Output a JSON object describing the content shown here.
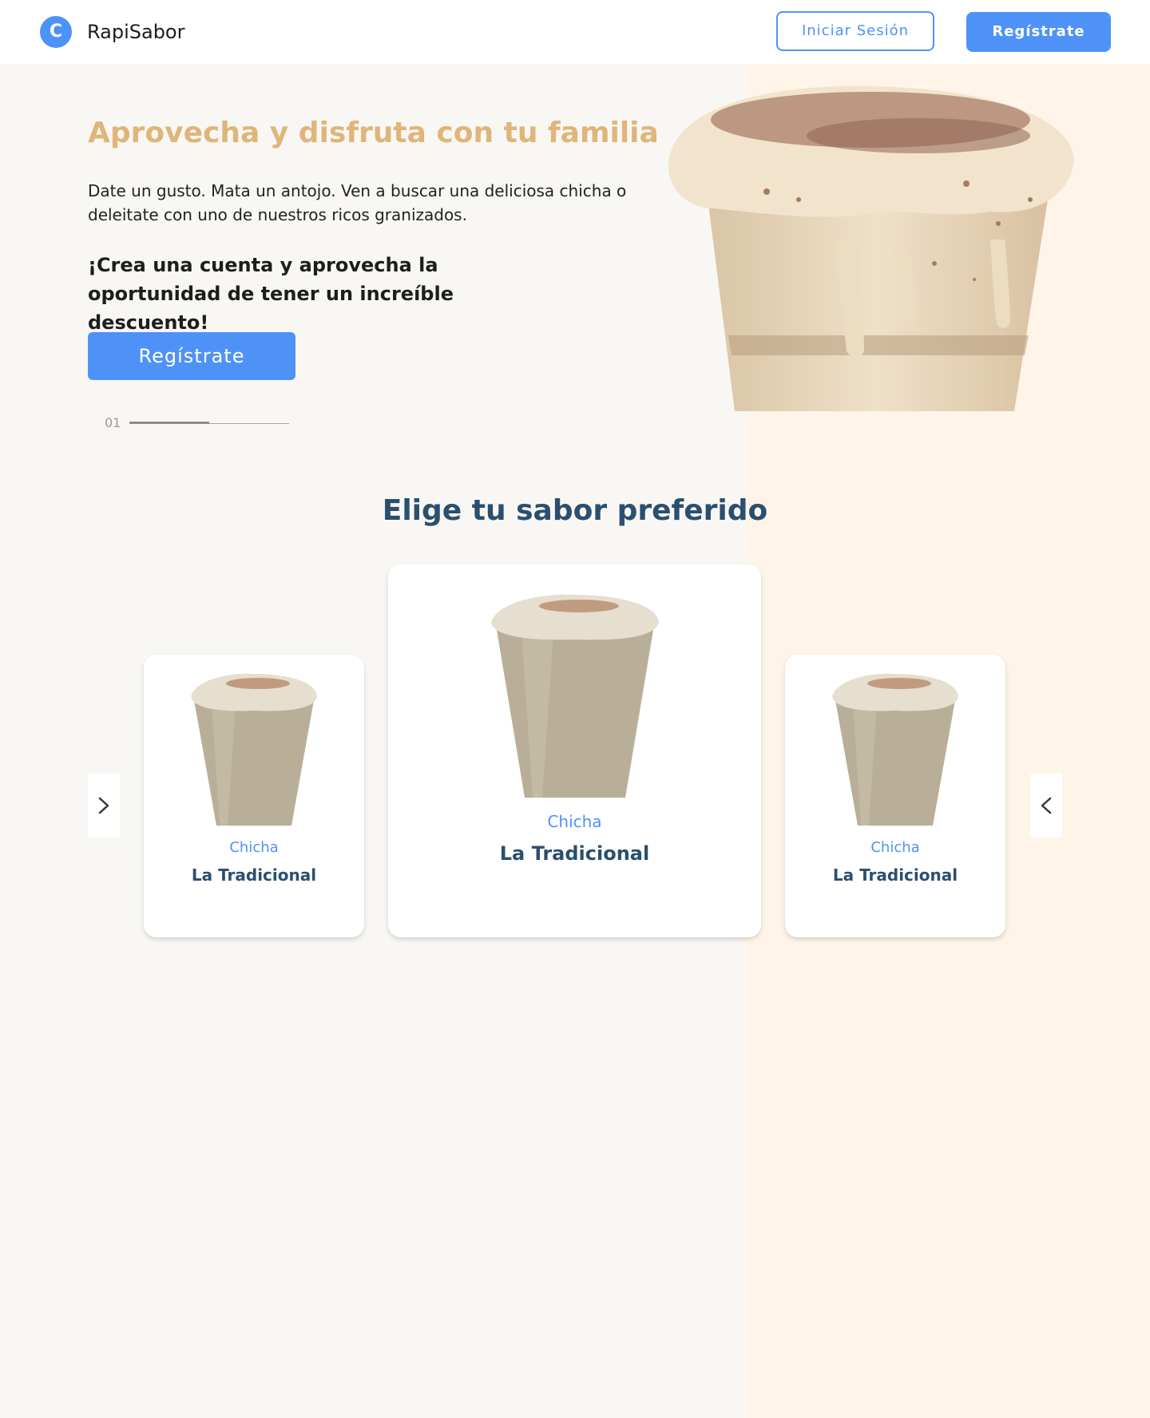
{
  "header": {
    "logo_letter": "C",
    "brand": "RapiSabor",
    "login_label": "Iniciar Sesión",
    "register_label": "Regístrate"
  },
  "hero": {
    "title": "Aprovecha y disfruta con tu familia",
    "description": "Date un gusto. Mata un antojo. Ven a buscar una deliciosa chicha o deleitate con uno de nuestros ricos granizados.",
    "cta_text": "¡Crea una cuenta y aprovecha la oportunidad de tener un increíble descuento!",
    "register_label": "Regístrate",
    "slide_index": "01",
    "slide_progress": 0.5
  },
  "flavors": {
    "title": "Elige tu sabor preferido",
    "cards": [
      {
        "category": "Chicha",
        "name": "La Tradicional"
      },
      {
        "category": "Chicha",
        "name": "La Tradicional"
      },
      {
        "category": "Chicha",
        "name": "La Tradicional"
      }
    ]
  },
  "icons": {
    "logo": "logo-c-icon",
    "prev": "chevron-right-icon",
    "next": "chevron-left-icon"
  },
  "colors": {
    "primary": "#4f92f7",
    "title_gold": "#e0b57a",
    "navy": "#2a4f6f",
    "bg_left": "#f8f7f4",
    "bg_right": "#fef4e8"
  }
}
